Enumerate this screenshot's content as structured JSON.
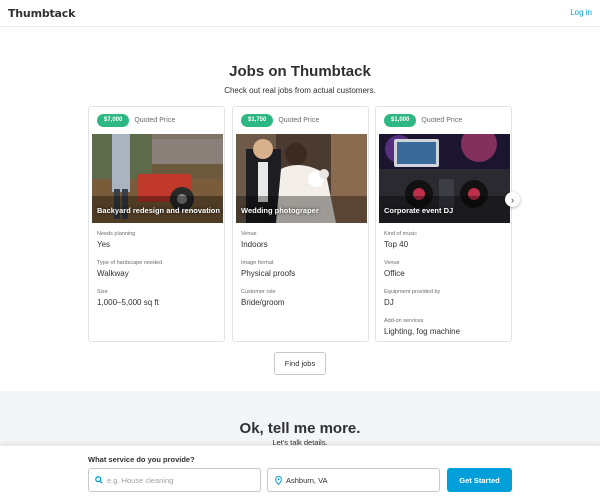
{
  "header": {
    "logo": "Thumbtack",
    "login": "Log in"
  },
  "jobs_section": {
    "title": "Jobs on Thumbtack",
    "subtitle": "Check out real jobs from actual customers.",
    "cards": [
      {
        "price": "$7,000",
        "price_label": "Quoted Price",
        "title": "Backyard redesign and renovation",
        "fields": [
          {
            "label": "Needs planning",
            "value": "Yes"
          },
          {
            "label": "Type of hardscape needed",
            "value": "Walkway"
          },
          {
            "label": "Size",
            "value": "1,000–5,000 sq ft"
          }
        ]
      },
      {
        "price": "$1,750",
        "price_label": "Quoted Price",
        "title": "Wedding photograper",
        "fields": [
          {
            "label": "Venue",
            "value": "Indoors"
          },
          {
            "label": "Image format",
            "value": "Physical proofs"
          },
          {
            "label": "Customer role",
            "value": "Bride/groom"
          }
        ]
      },
      {
        "price": "$1,000",
        "price_label": "Quoted Price",
        "title": "Corporate event DJ",
        "fields": [
          {
            "label": "Kind of music",
            "value": "Top 40"
          },
          {
            "label": "Venue",
            "value": "Office"
          },
          {
            "label": "Equipment provided by",
            "value": "DJ"
          },
          {
            "label": "Add-on services",
            "value": "Lighting, fog machine"
          }
        ]
      }
    ],
    "next_icon": "chevron-right-icon",
    "find_jobs": "Find jobs"
  },
  "tell_more": {
    "title": "Ok, tell me more.",
    "subtitle": "Let’s talk details."
  },
  "bottom_bar": {
    "label": "What service do you provide?",
    "service_placeholder": "e.g. House cleaning",
    "location_value": "Ashburn, VA",
    "button": "Get Started"
  },
  "colors": {
    "brand_blue": "#009fd9",
    "price_green": "#2db783",
    "text": "#2f3033"
  }
}
